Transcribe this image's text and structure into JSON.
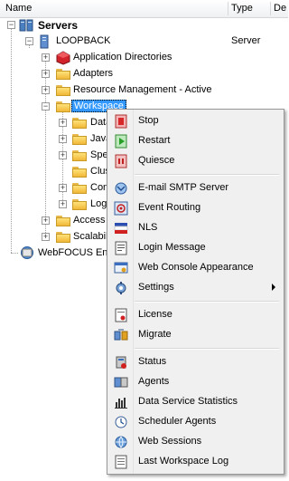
{
  "columns": {
    "name": "Name",
    "type": "Type",
    "desc": "De"
  },
  "tree": {
    "servers": "Servers",
    "loopback": "LOOPBACK",
    "loopback_type": "Server",
    "application_directories": "Application Directories",
    "adapters": "Adapters",
    "resource_management": "Resource Management  - Active",
    "workspace": "Workspace",
    "children": [
      "Data",
      "Java",
      "Spec",
      "Clus",
      "Con",
      "Logs"
    ],
    "access": "Access C",
    "scalability": "Scalabili",
    "webfocus": "WebFOCUS Env"
  },
  "menu": {
    "items": [
      {
        "label": "Stop",
        "icon": "stop-icon"
      },
      {
        "label": "Restart",
        "icon": "restart-icon"
      },
      {
        "label": "Quiesce",
        "icon": "quiesce-icon"
      },
      {
        "label": "E-mail SMTP Server",
        "icon": "smtp-icon"
      },
      {
        "label": "Event Routing",
        "icon": "event-routing-icon"
      },
      {
        "label": "NLS",
        "icon": "nls-icon"
      },
      {
        "label": "Login Message",
        "icon": "login-message-icon"
      },
      {
        "label": "Web Console Appearance",
        "icon": "appearance-icon"
      },
      {
        "label": "Settings",
        "icon": "settings-icon"
      },
      {
        "label": "License",
        "icon": "license-icon"
      },
      {
        "label": "Migrate",
        "icon": "migrate-icon"
      },
      {
        "label": "Status",
        "icon": "status-icon"
      },
      {
        "label": "Agents",
        "icon": "agents-icon"
      },
      {
        "label": "Data Service Statistics",
        "icon": "statistics-icon"
      },
      {
        "label": "Scheduler Agents",
        "icon": "scheduler-icon"
      },
      {
        "label": "Web Sessions",
        "icon": "web-sessions-icon"
      },
      {
        "label": "Last Workspace Log",
        "icon": "log-icon"
      }
    ]
  }
}
